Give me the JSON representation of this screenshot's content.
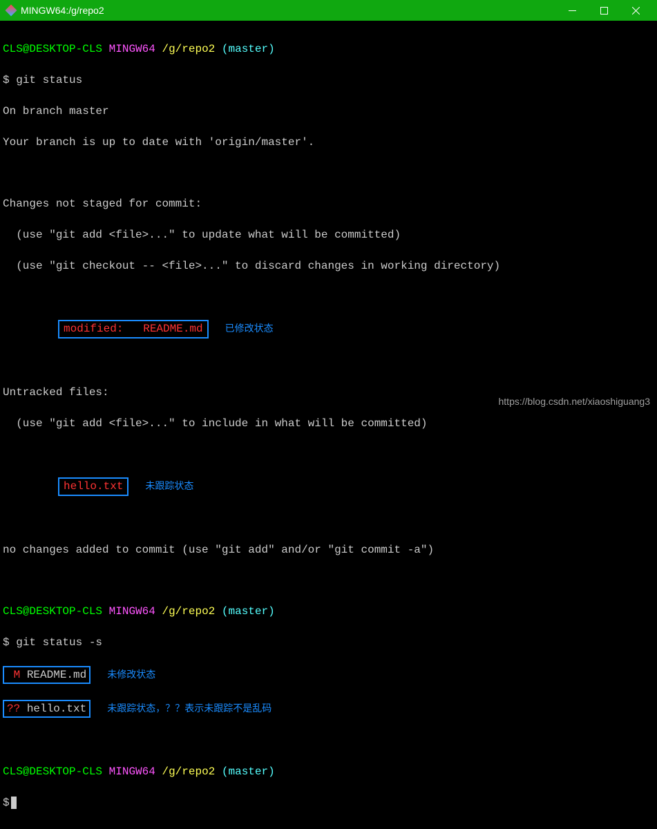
{
  "window": {
    "title": "MINGW64:/g/repo2"
  },
  "prompt1": {
    "user": "CLS@DESKTOP-CLS",
    "env": "MINGW64",
    "path": "/g/repo2",
    "branch": "(master)"
  },
  "cmd1": {
    "prompt": "$",
    "text": " git status"
  },
  "status": {
    "l1": "On branch master",
    "l2": "Your branch is up to date with 'origin/master'.",
    "l_blank1": "",
    "changes_header": "Changes not staged for commit:",
    "hint_add": "  (use \"git add <file>...\" to update what will be committed)",
    "hint_checkout": "  (use \"git checkout -- <file>...\" to discard changes in working directory)",
    "modified_line": "modified:   README.md",
    "modified_label": "已修改状态",
    "untracked_header": "Untracked files:",
    "hint_untracked": "  (use \"git add <file>...\" to include in what will be committed)",
    "untracked_file": "hello.txt",
    "untracked_label": "未跟踪状态",
    "no_changes": "no changes added to commit (use \"git add\" and/or \"git commit -a\")"
  },
  "prompt2": {
    "user": "CLS@DESKTOP-CLS",
    "env": "MINGW64",
    "path": "/g/repo2",
    "branch": "(master)"
  },
  "cmd2": {
    "prompt": "$",
    "text": " git status -s"
  },
  "short": {
    "r1_flag": " M",
    "r1_file": "README.md",
    "r1_label": "未修改状态",
    "r2_flag": "??",
    "r2_file": "hello.txt",
    "r2_label": "未跟踪状态，？？表示未跟踪不是乱码"
  },
  "prompt3": {
    "user": "CLS@DESKTOP-CLS",
    "env": "MINGW64",
    "path": "/g/repo2",
    "branch": "(master)"
  },
  "cmd3": {
    "prompt": "$"
  },
  "watermark": "https://blog.csdn.net/xiaoshiguang3"
}
